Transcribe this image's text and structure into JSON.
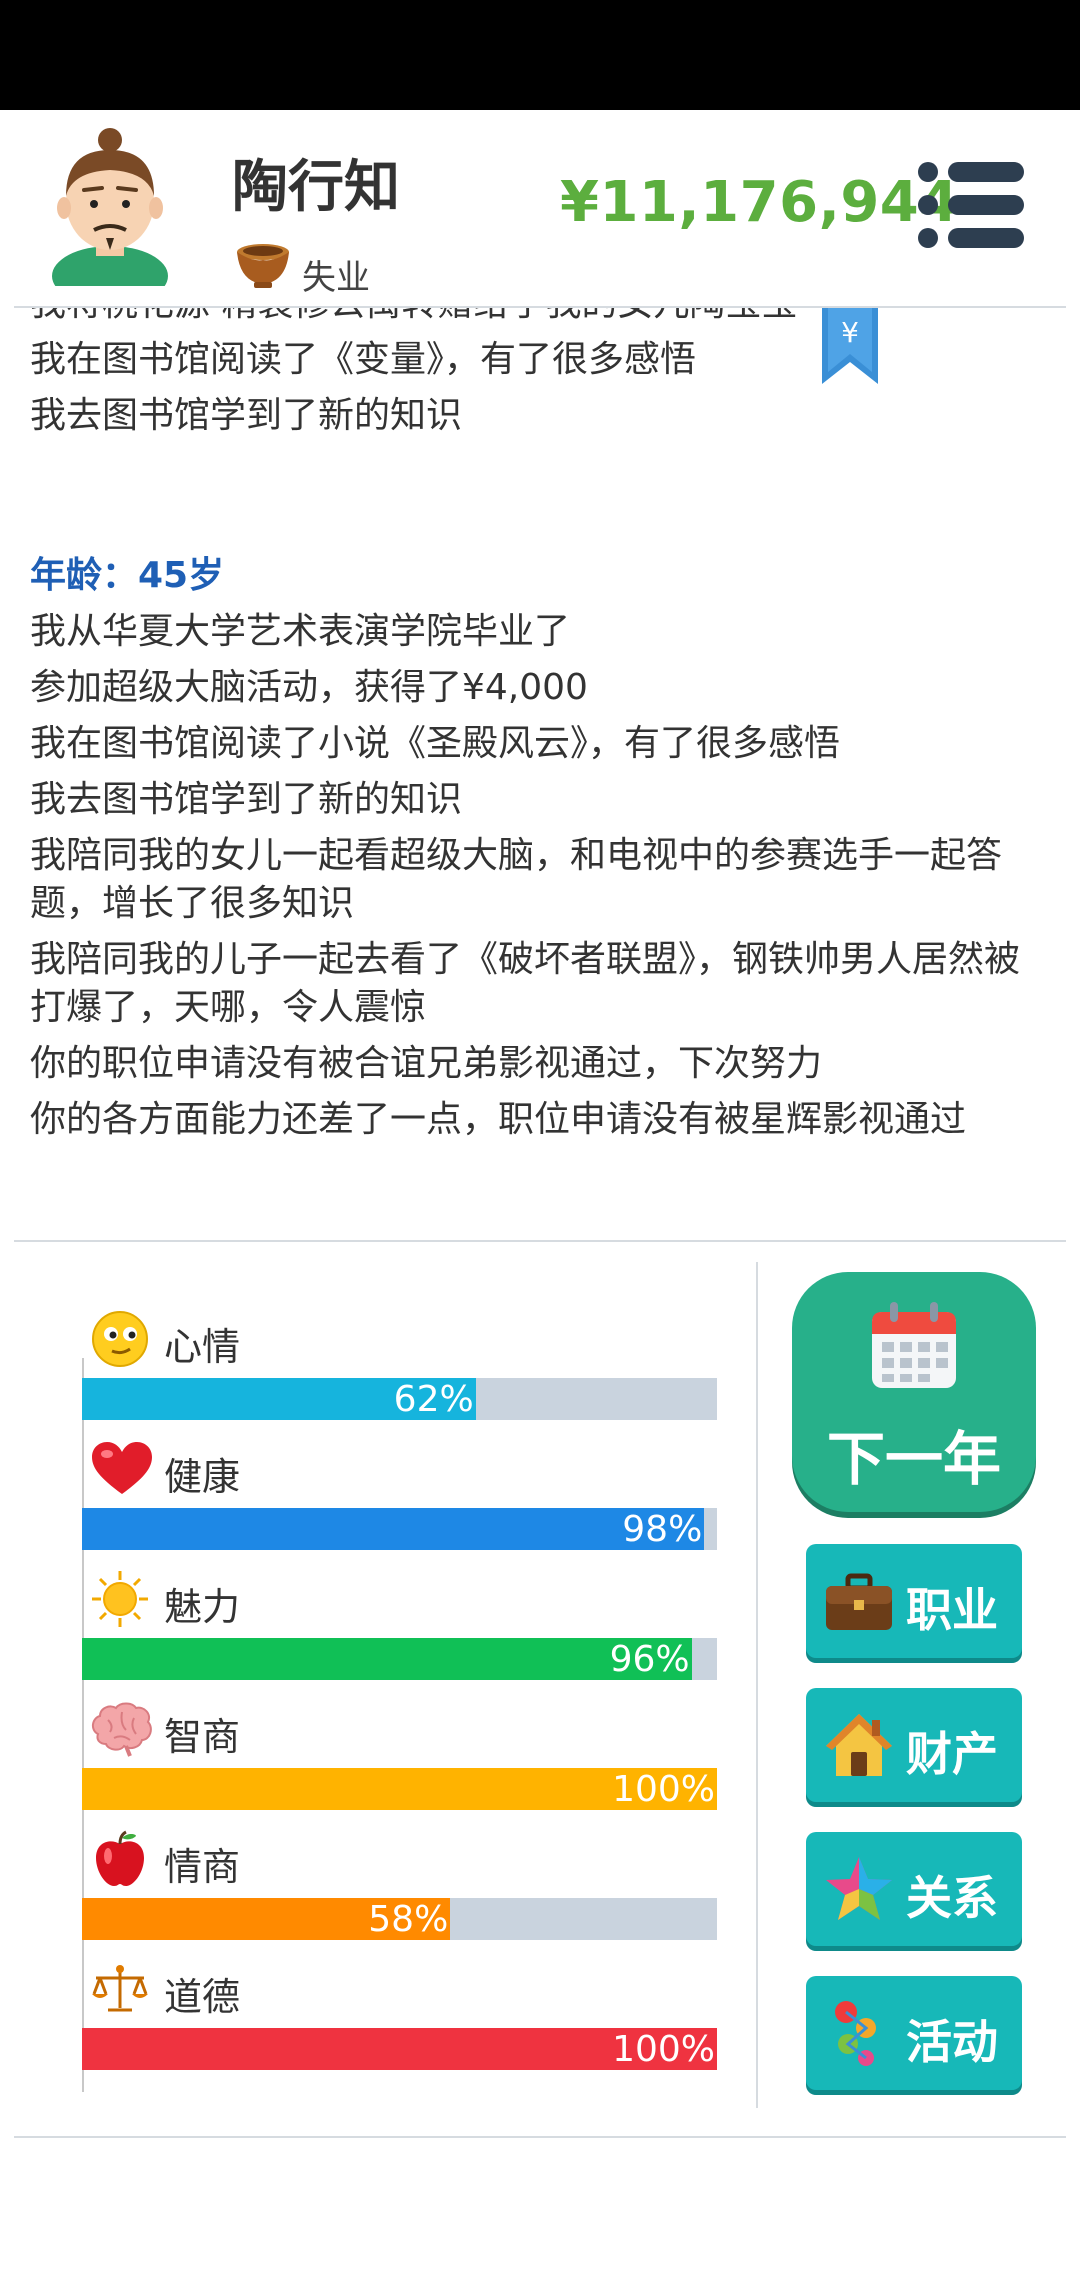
{
  "player": {
    "name": "陶行知",
    "status": "失业",
    "money": "¥11,176,944"
  },
  "log": {
    "entries_before": [
      "我将桃花源·精装修公寓转赠给了我的女儿陶宝宝",
      "我在图书馆阅读了《变量》，有了很多感悟",
      "我去图书馆学到了新的知识"
    ],
    "age_header": "年龄：45岁",
    "entries": [
      "我从华夏大学艺术表演学院毕业了",
      "参加超级大脑活动，获得了¥4,000",
      "我在图书馆阅读了小说《圣殿风云》，有了很多感悟",
      "我去图书馆学到了新的知识",
      "我陪同我的女儿一起看超级大脑，和电视中的参赛选手一起答题，增长了很多知识",
      "我陪同我的儿子一起去看了《破坏者联盟》，钢铁帅男人居然被打爆了，天哪，令人震惊",
      "你的职位申请没有被合谊兄弟影视通过，下次努力",
      "你的各方面能力还差了一点，职位申请没有被星辉影视通过"
    ],
    "bookmark_symbol": "¥"
  },
  "stats": [
    {
      "label": "心情",
      "value": 62,
      "display": "62%",
      "color": "#16b4dd",
      "icon": "smiley-icon"
    },
    {
      "label": "健康",
      "value": 98,
      "display": "98%",
      "color": "#1e88e5",
      "icon": "heart-icon"
    },
    {
      "label": "魅力",
      "value": 96,
      "display": "96%",
      "color": "#10c056",
      "icon": "sun-icon"
    },
    {
      "label": "智商",
      "value": 100,
      "display": "100%",
      "color": "#ffb300",
      "icon": "brain-icon"
    },
    {
      "label": "情商",
      "value": 58,
      "display": "58%",
      "color": "#ff8a00",
      "icon": "apple-icon"
    },
    {
      "label": "道德",
      "value": 100,
      "display": "100%",
      "color": "#ef3340",
      "icon": "scales-icon"
    }
  ],
  "actions": {
    "next_year": "下一年",
    "career": "职业",
    "property": "财产",
    "relations": "关系",
    "activities": "活动"
  }
}
